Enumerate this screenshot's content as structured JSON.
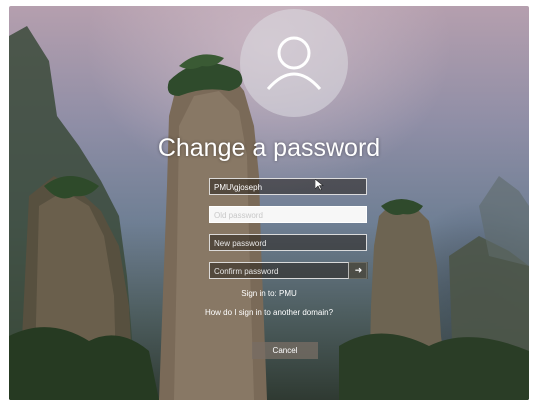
{
  "screen": {
    "title": "Change a password",
    "form": {
      "username_value": "PMU\\gjoseph",
      "old_password_placeholder": "Old password",
      "new_password_placeholder": "New password",
      "confirm_password_placeholder": "Confirm password",
      "submit_icon": "arrow-right-icon"
    },
    "sign_in_to": "Sign in to: PMU",
    "other_domain_link": "How do I sign in to another domain?",
    "cancel_label": "Cancel"
  },
  "colors": {
    "text": "#ffffff",
    "field_background": "#3a332e",
    "focused_field": "#f7f7f7"
  }
}
